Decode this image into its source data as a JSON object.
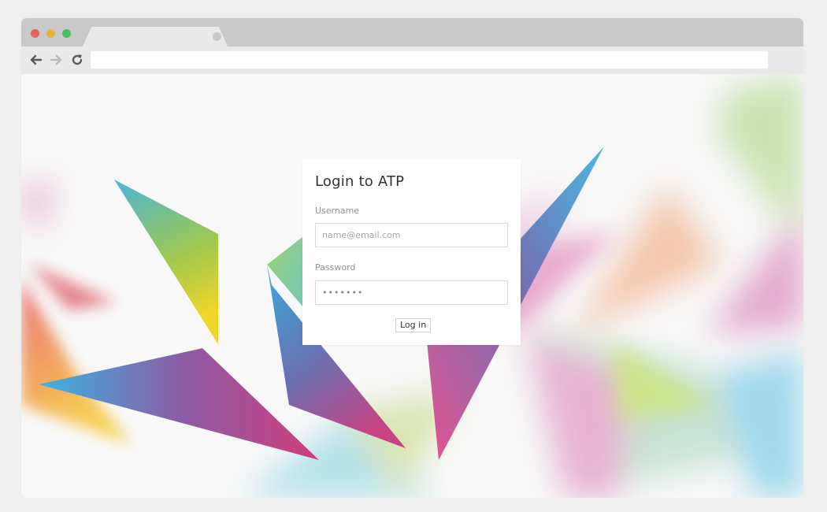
{
  "browser": {
    "address_value": "",
    "window_controls": [
      "close",
      "minimize",
      "maximize"
    ],
    "nav_icons": [
      "back-arrow-icon",
      "forward-arrow-icon",
      "reload-icon"
    ]
  },
  "login": {
    "title": "Login to ATP",
    "username_label": "Username",
    "username_placeholder": "name@email.com",
    "username_value": "",
    "password_label": "Password",
    "password_value": "•••••••",
    "submit_label": "Log in"
  },
  "colors": {
    "window_close": "#ec5f57",
    "window_minimize": "#e6b43a",
    "window_maximize": "#45c15f",
    "page_background": "#f8f8f8",
    "card_background": "#ffffff"
  }
}
